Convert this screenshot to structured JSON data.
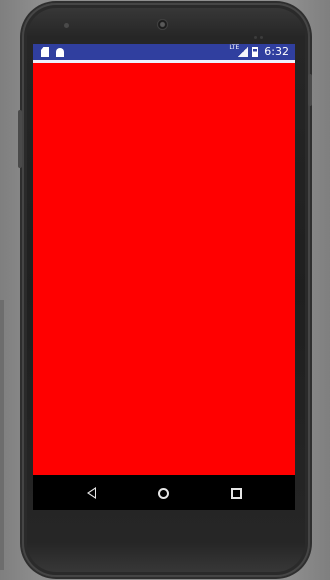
{
  "status_bar": {
    "network_label": "LTE",
    "time": "6:32",
    "color": "#303f9f",
    "icons": [
      "sd-card-icon",
      "android-icon",
      "signal-icon",
      "battery-icon"
    ]
  },
  "app": {
    "background_color": "#ff0000"
  },
  "navigation": {
    "buttons": [
      {
        "name": "back",
        "icon": "back-triangle-icon"
      },
      {
        "name": "home",
        "icon": "home-circle-icon"
      },
      {
        "name": "recents",
        "icon": "recents-square-icon"
      }
    ]
  }
}
